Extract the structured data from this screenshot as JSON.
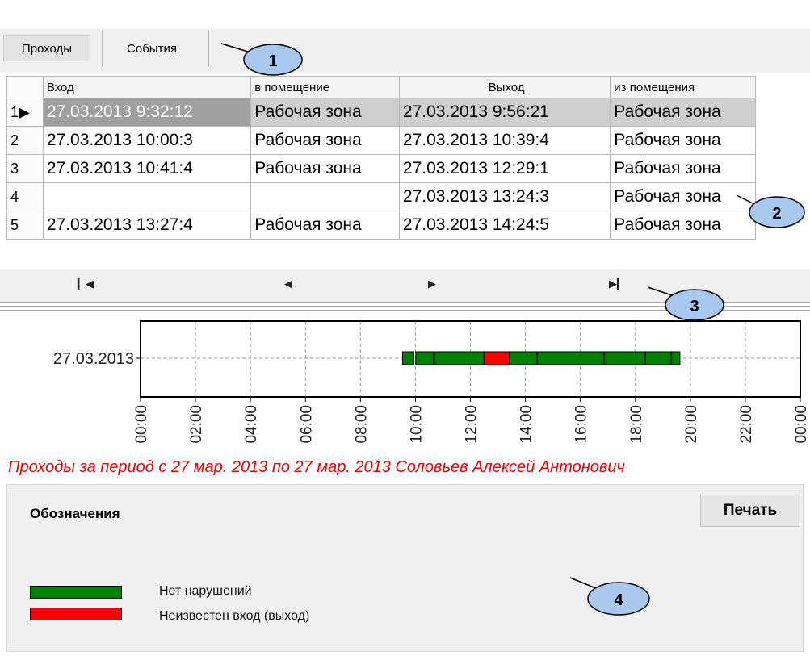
{
  "tabs": {
    "passes": "Проходы",
    "events": "События"
  },
  "table": {
    "headers": [
      "Вход",
      "в помещение",
      "Выход",
      "из помещения"
    ],
    "rows": [
      {
        "n": "1",
        "entry": "27.03.2013 9:32:12",
        "entry_zone": "Рабочая зона",
        "exit": "27.03.2013 9:56:21",
        "exit_zone": "Рабочая зона"
      },
      {
        "n": "2",
        "entry": "27.03.2013 10:00:3",
        "entry_zone": "Рабочая зона",
        "exit": "27.03.2013 10:39:4",
        "exit_zone": "Рабочая зона"
      },
      {
        "n": "3",
        "entry": "27.03.2013 10:41:4",
        "entry_zone": "Рабочая зона",
        "exit": "27.03.2013 12:29:1",
        "exit_zone": "Рабочая зона"
      },
      {
        "n": "4",
        "entry": "",
        "entry_zone": "",
        "exit": "27.03.2013 13:24:3",
        "exit_zone": "Рабочая зона"
      },
      {
        "n": "5",
        "entry": "27.03.2013 13:27:4",
        "entry_zone": "Рабочая зона",
        "exit": "27.03.2013 14:24:5",
        "exit_zone": "Рабочая зона"
      }
    ]
  },
  "navigator": {
    "first_icon": "first-record-icon",
    "prev_icon": "prev-record-icon",
    "next_icon": "next-record-icon",
    "last_icon": "last-record-icon"
  },
  "chart_data": {
    "type": "bar",
    "orientation": "horizontal-timeline",
    "y_categories": [
      "27.03.2013"
    ],
    "x_ticks": [
      "00:00",
      "02:00",
      "04:00",
      "06:00",
      "08:00",
      "10:00",
      "12:00",
      "14:00",
      "16:00",
      "18:00",
      "20:00",
      "22:00",
      "00:00"
    ],
    "xlim_hours": [
      0,
      24
    ],
    "grid": true,
    "segments": [
      {
        "start": 9.53,
        "end": 9.94,
        "status": "ok"
      },
      {
        "start": 10.01,
        "end": 10.66,
        "status": "ok"
      },
      {
        "start": 10.69,
        "end": 12.49,
        "status": "ok"
      },
      {
        "start": 12.49,
        "end": 13.41,
        "status": "unknown"
      },
      {
        "start": 13.41,
        "end": 14.42,
        "status": "ok"
      },
      {
        "start": 14.44,
        "end": 16.85,
        "status": "ok"
      },
      {
        "start": 16.87,
        "end": 18.35,
        "status": "ok"
      },
      {
        "start": 18.37,
        "end": 19.3,
        "status": "ok"
      },
      {
        "start": 19.32,
        "end": 19.62,
        "status": "ok"
      }
    ],
    "status_colors": {
      "ok": "#008000",
      "unknown": "#ff0000"
    }
  },
  "caption": "Проходы за период с 27 мар. 2013  по 27 мар. 2013 Соловьев Алексей Антонович",
  "legend": {
    "title": "Обозначения",
    "print_label": "Печать",
    "items": [
      {
        "label": "Нет нарушений",
        "color": "#008000"
      },
      {
        "label": "Неизвестен вход (выход)",
        "color": "#ff0000"
      }
    ]
  },
  "callouts": [
    "1",
    "2",
    "3",
    "4"
  ]
}
